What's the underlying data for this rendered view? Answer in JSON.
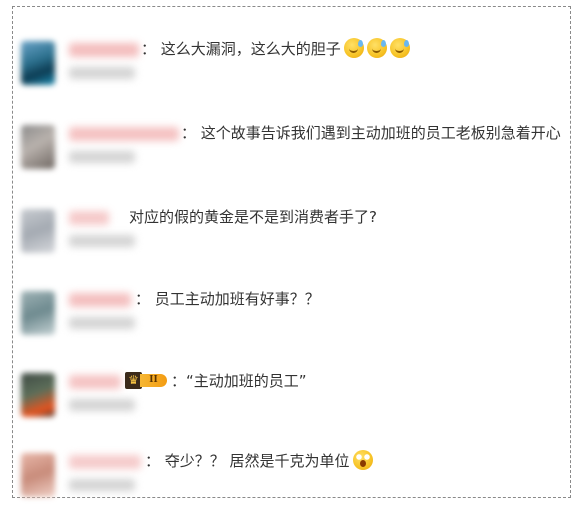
{
  "comments": [
    {
      "text": "： 这么大漏洞，这么大的胆子",
      "emojis": [
        "sweat-emoji",
        "sweat-emoji",
        "sweat-emoji"
      ]
    },
    {
      "text": "： 这个故事告诉我们遇到主动加班的员工老板别急着开心"
    },
    {
      "text": "对应的假的黄金是不是到消费者手了?"
    },
    {
      "text": "： 员工主动加班有好事？？"
    },
    {
      "badge": {
        "icon": "crown-icon",
        "level": "II"
      },
      "text": "：“主动加班的员工”"
    },
    {
      "text": "： 夺少？？ 居然是千克为单位",
      "emojis": [
        "shocked-emoji"
      ]
    }
  ]
}
